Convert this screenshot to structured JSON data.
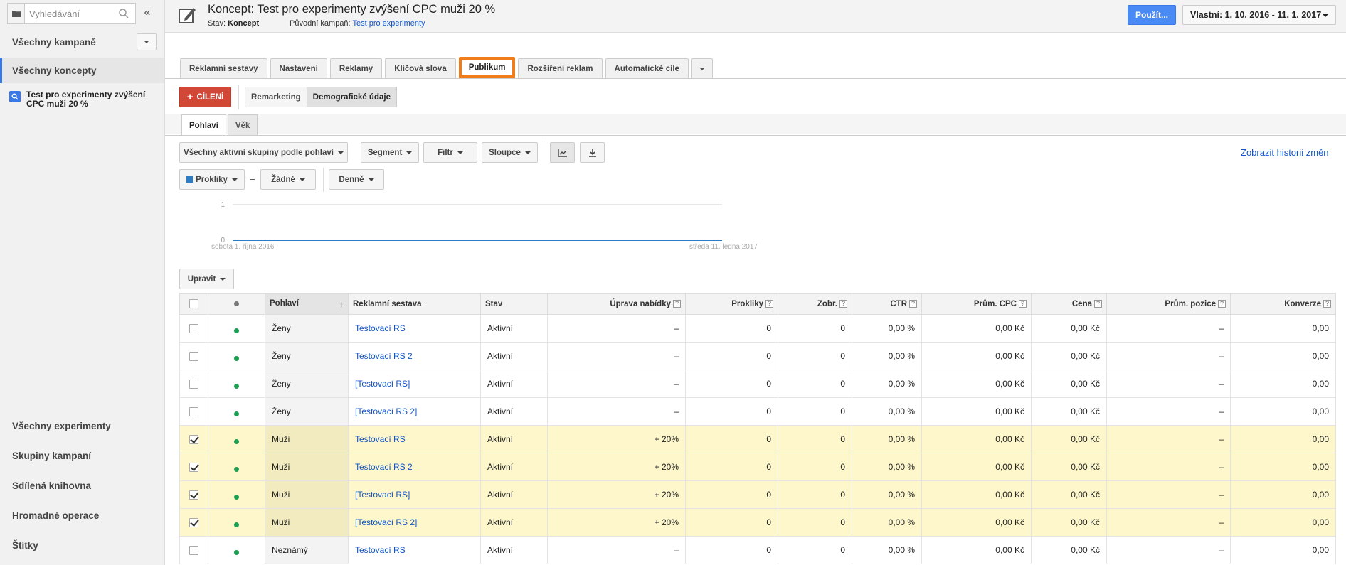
{
  "sidebar": {
    "search_placeholder": "Vyhledávání",
    "collapse_glyph": "«",
    "campaigns_label": "Všechny kampaně",
    "drafts_label": "Všechny koncepty",
    "draft_item": "Test pro experimenty zvýšení CPC muži 20 %",
    "bottom_items": [
      "Všechny experimenty",
      "Skupiny kampaní",
      "Sdílená knihovna",
      "Hromadné operace",
      "Štítky"
    ]
  },
  "header": {
    "title": "Koncept: Test pro experimenty zvýšení CPC muži 20 %",
    "status_label": "Stav:",
    "status_value": "Koncept",
    "parent_label": "Původní kampaň:",
    "parent_value": "Test pro experimenty",
    "apply_label": "Použít...",
    "date_range": "Vlastní: 1. 10. 2016 - 11. 1. 2017"
  },
  "tabs": [
    "Reklamní sestavy",
    "Nastavení",
    "Reklamy",
    "Klíčová slova",
    "Publikum",
    "Rozšíření reklam",
    "Automatické cíle"
  ],
  "active_tab": "Publikum",
  "targeting": {
    "add_label": "CÍLENÍ",
    "segments": [
      "Remarketing",
      "Demografické údaje"
    ],
    "selected_segment": "Demografické údaje"
  },
  "subtabs": [
    "Pohlaví",
    "Věk"
  ],
  "toolbar": {
    "groups_filter": "Všechny aktivní skupiny podle pohlaví",
    "segment": "Segment",
    "filter": "Filtr",
    "columns": "Sloupce",
    "history_link": "Zobrazit historii změn",
    "metric1": "Prokliky",
    "dash": "–",
    "metric2": "Žádné",
    "period": "Denně",
    "edit": "Upravit"
  },
  "chart_data": {
    "type": "line",
    "x_start_label": "sobota 1. října 2016",
    "x_end_label": "středa 11. ledna 2017",
    "y_ticks": [
      "0",
      "1"
    ],
    "ylim": [
      0,
      1
    ],
    "series": [
      {
        "name": "Prokliky",
        "values": [
          0,
          0
        ]
      }
    ],
    "colors": {
      "series": "#2d7cc6"
    }
  },
  "table": {
    "columns": [
      "Pohlaví",
      "Reklamní sestava",
      "Stav",
      "Úprava nabídky",
      "Prokliky",
      "Zobr.",
      "CTR",
      "Prům. CPC",
      "Cena",
      "Prům. pozice",
      "Konverze"
    ],
    "help_glyph": "?",
    "sort_glyph": "↑",
    "rows": [
      {
        "checked": false,
        "gender": "Ženy",
        "adgroup": "Testovací RS",
        "status": "Aktivní",
        "bid": "–",
        "clicks": "0",
        "impr": "0",
        "ctr": "0,00 %",
        "cpc": "0,00 Kč",
        "cost": "0,00 Kč",
        "pos": "–",
        "conv": "0,00"
      },
      {
        "checked": false,
        "gender": "Ženy",
        "adgroup": "Testovací RS 2",
        "status": "Aktivní",
        "bid": "–",
        "clicks": "0",
        "impr": "0",
        "ctr": "0,00 %",
        "cpc": "0,00 Kč",
        "cost": "0,00 Kč",
        "pos": "–",
        "conv": "0,00"
      },
      {
        "checked": false,
        "gender": "Ženy",
        "adgroup": "[Testovací RS]",
        "status": "Aktivní",
        "bid": "–",
        "clicks": "0",
        "impr": "0",
        "ctr": "0,00 %",
        "cpc": "0,00 Kč",
        "cost": "0,00 Kč",
        "pos": "–",
        "conv": "0,00"
      },
      {
        "checked": false,
        "gender": "Ženy",
        "adgroup": "[Testovací RS 2]",
        "status": "Aktivní",
        "bid": "–",
        "clicks": "0",
        "impr": "0",
        "ctr": "0,00 %",
        "cpc": "0,00 Kč",
        "cost": "0,00 Kč",
        "pos": "–",
        "conv": "0,00"
      },
      {
        "checked": true,
        "gender": "Muži",
        "adgroup": "Testovací RS",
        "status": "Aktivní",
        "bid": "+ 20%",
        "clicks": "0",
        "impr": "0",
        "ctr": "0,00 %",
        "cpc": "0,00 Kč",
        "cost": "0,00 Kč",
        "pos": "–",
        "conv": "0,00"
      },
      {
        "checked": true,
        "gender": "Muži",
        "adgroup": "Testovací RS 2",
        "status": "Aktivní",
        "bid": "+ 20%",
        "clicks": "0",
        "impr": "0",
        "ctr": "0,00 %",
        "cpc": "0,00 Kč",
        "cost": "0,00 Kč",
        "pos": "–",
        "conv": "0,00"
      },
      {
        "checked": true,
        "gender": "Muži",
        "adgroup": "[Testovací RS]",
        "status": "Aktivní",
        "bid": "+ 20%",
        "clicks": "0",
        "impr": "0",
        "ctr": "0,00 %",
        "cpc": "0,00 Kč",
        "cost": "0,00 Kč",
        "pos": "–",
        "conv": "0,00"
      },
      {
        "checked": true,
        "gender": "Muži",
        "adgroup": "[Testovací RS 2]",
        "status": "Aktivní",
        "bid": "+ 20%",
        "clicks": "0",
        "impr": "0",
        "ctr": "0,00 %",
        "cpc": "0,00 Kč",
        "cost": "0,00 Kč",
        "pos": "–",
        "conv": "0,00"
      },
      {
        "checked": false,
        "gender": "Neznámý",
        "adgroup": "Testovací RS",
        "status": "Aktivní",
        "bid": "–",
        "clicks": "0",
        "impr": "0",
        "ctr": "0,00 %",
        "cpc": "0,00 Kč",
        "cost": "0,00 Kč",
        "pos": "–",
        "conv": "0,00"
      }
    ]
  },
  "colors": {
    "accent_blue": "#4a8af4",
    "link": "#1155cc",
    "danger_red": "#d14836",
    "highlight_orange": "#f07d1a",
    "selected_row": "#fdf7cb",
    "status_green": "#1e9e52"
  }
}
